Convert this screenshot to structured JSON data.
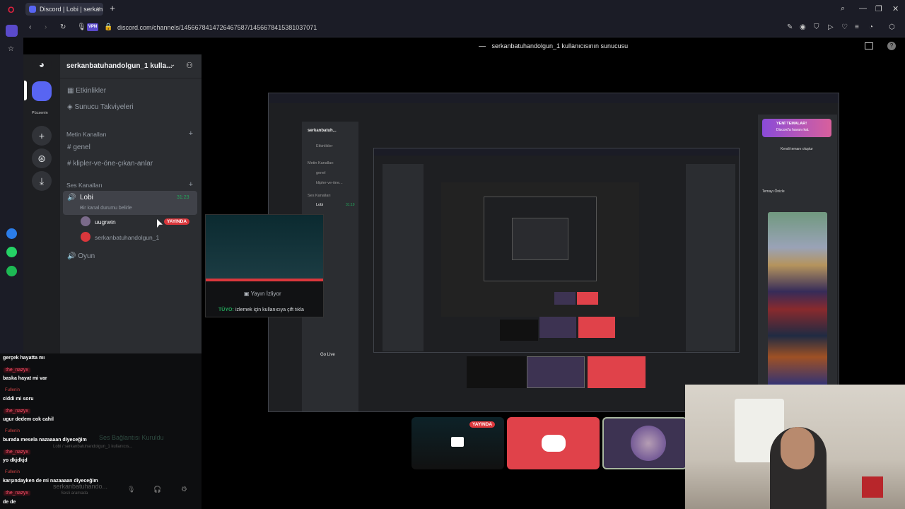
{
  "browser": {
    "tab_title": "Discord | Lobi | serkan",
    "url": "discord.com/channels/1456678414726467587/1456678415381037071",
    "vpn": "VPN"
  },
  "stream_title": "serkanbatuhandolgun_1 kullanıcısının sunucusu",
  "server": {
    "name": "serkanbatuhandolgun_1 kulla...",
    "guild_label": "Pücsenin",
    "items": [
      "Etkinlikler",
      "Sunucu Takviyeleri"
    ],
    "text_category": "Metin Kanalları",
    "text_channels": [
      "genel",
      "klipler-ve-öne-çıkan-anlar"
    ],
    "voice_category": "Ses Kanalları",
    "voice_channel": "Lobi",
    "voice_time": "31:23",
    "voice_status": "Bir kanal durumu belirle",
    "members": [
      {
        "name": "uugrwin",
        "live": "YAYINDA"
      },
      {
        "name": "serkanbatuhandolgun_1"
      }
    ],
    "other_voice": "Oyun"
  },
  "popup": {
    "watching": "Yayın İzliyor",
    "tip_label": "TÜYO:",
    "tip": "izlemek için kullanıcıya çift tıkla"
  },
  "chat": [
    {
      "type": "msg",
      "text": "gerçek hayatta mı"
    },
    {
      "type": "name",
      "text": "the_nazyx"
    },
    {
      "type": "msg",
      "text": "baska hayat mi var"
    },
    {
      "type": "badge",
      "text": "Fullenin"
    },
    {
      "type": "msg",
      "text": "ciddi mi soru"
    },
    {
      "type": "name",
      "text": "the_nazyx"
    },
    {
      "type": "msg",
      "text": "ugur dedem cok cahil"
    },
    {
      "type": "badge",
      "text": "Fullenin"
    },
    {
      "type": "msg",
      "text": "burada mesela nazaaaan diyeceğim"
    },
    {
      "type": "name",
      "text": "the_nazyx"
    },
    {
      "type": "msg",
      "text": "yo dkjdkjd"
    },
    {
      "type": "badge",
      "text": "Fullenin"
    },
    {
      "type": "msg",
      "text": "karşındayken de mi nazaaaan diyeceğim"
    },
    {
      "type": "name",
      "text": "the_nazyx"
    },
    {
      "type": "msg",
      "text": "de de"
    }
  ],
  "bottom": {
    "connected": "Ses Bağlantısı Kuruldu",
    "connected_sub": "Lobi / serkanbatuhandolgun_1 kullanıcıs...",
    "user": "serkanbatuhando...",
    "user_status": "Sesli aramada"
  },
  "tiles": {
    "live": "YAYINDA"
  },
  "nested": {
    "server_name": "serkanbatuh...",
    "items": [
      "Etkinlikler",
      "Metin Kanalları",
      "genel",
      "klipler-ve-öne...",
      "Ses Kanalları",
      "Lobi"
    ],
    "time": "31:19",
    "go_live": "Go Live",
    "theme_new": "YENİ TEMALAR!",
    "theme_sub": "Discord'a havanı kat.",
    "theme_create": "Kendi temanı oluştur",
    "theme_preview": "Temayı Önizle"
  },
  "colors": {
    "accent": "#5865f2",
    "live": "#da373c",
    "green": "#23a55a"
  }
}
